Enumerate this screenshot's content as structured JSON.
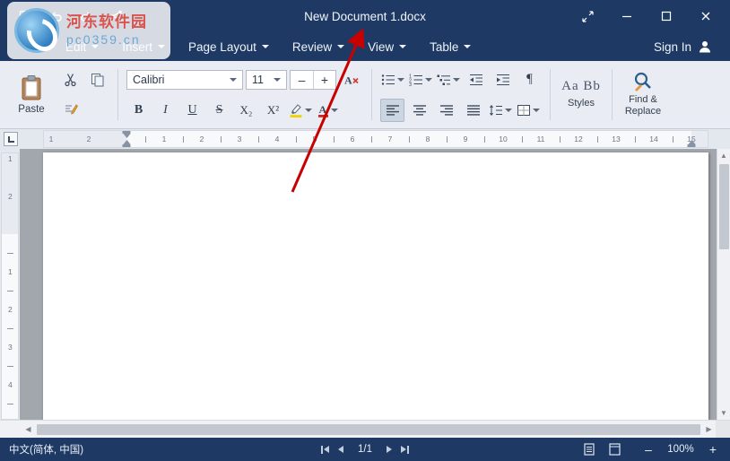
{
  "titlebar": {
    "title": "New Document 1.docx"
  },
  "menubar": {
    "items": [
      {
        "label": "Edit"
      },
      {
        "label": "Insert"
      },
      {
        "label": "Page Layout"
      },
      {
        "label": "Review"
      },
      {
        "label": "View"
      },
      {
        "label": "Table"
      }
    ],
    "sign_in_label": "Sign In"
  },
  "ribbon": {
    "paste_label": "Paste",
    "font_name": "Calibri",
    "font_size": "11",
    "decrease_font": "–",
    "increase_font": "+",
    "bold": "B",
    "italic": "I",
    "underline": "U",
    "strikethrough": "S",
    "subscript": "X₂",
    "superscript": "X²",
    "font_color_letter": "A",
    "pilcrow": "¶",
    "styles_preview": "Aa Bb",
    "styles_label": "Styles",
    "find_replace_label": "Find & Replace"
  },
  "ruler": {
    "h_margin_numbers": [
      "2",
      "1"
    ],
    "h_numbers": [
      "1",
      "2",
      "3",
      "4",
      "5",
      "6",
      "7",
      "8",
      "9",
      "10",
      "11",
      "12",
      "13",
      "14",
      "15"
    ],
    "v_margin_numbers": [
      "2",
      "1"
    ],
    "v_numbers": [
      "1",
      "2",
      "3",
      "4"
    ]
  },
  "statusbar": {
    "language": "中文(简体, 中国)",
    "page_indicator": "1/1",
    "zoom_out": "–",
    "zoom_level": "100%",
    "zoom_in": "+"
  },
  "watermark": {
    "site_name": "河东软件园",
    "site_url": "pc0359.cn"
  }
}
